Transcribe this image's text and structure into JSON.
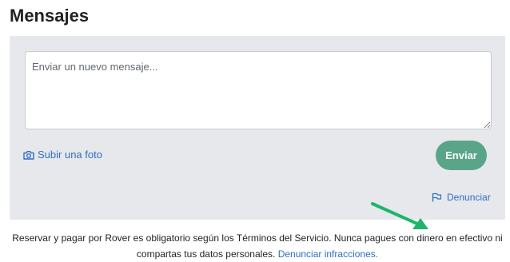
{
  "page": {
    "title": "Mensajes"
  },
  "composer": {
    "placeholder": "Enviar un nuevo mensaje...",
    "upload_label": "Subir una foto",
    "send_label": "Enviar",
    "report_label": "Denunciar"
  },
  "icons": {
    "camera": "camera-icon",
    "flag": "flag-icon",
    "resize": "resize-handle-icon",
    "arrow": "green-arrow-annotation"
  },
  "colors": {
    "accent_green": "#5aa58a",
    "link_blue": "#2f6fc1",
    "panel_bg": "#e6e8ec",
    "annotation_green": "#1db56a"
  },
  "footer": {
    "text": "Reservar y pagar por Rover es obligatorio según los Términos del Servicio. Nunca pagues con dinero en efectivo ni compartas tus datos personales.",
    "link_label": "Denunciar infracciones."
  }
}
